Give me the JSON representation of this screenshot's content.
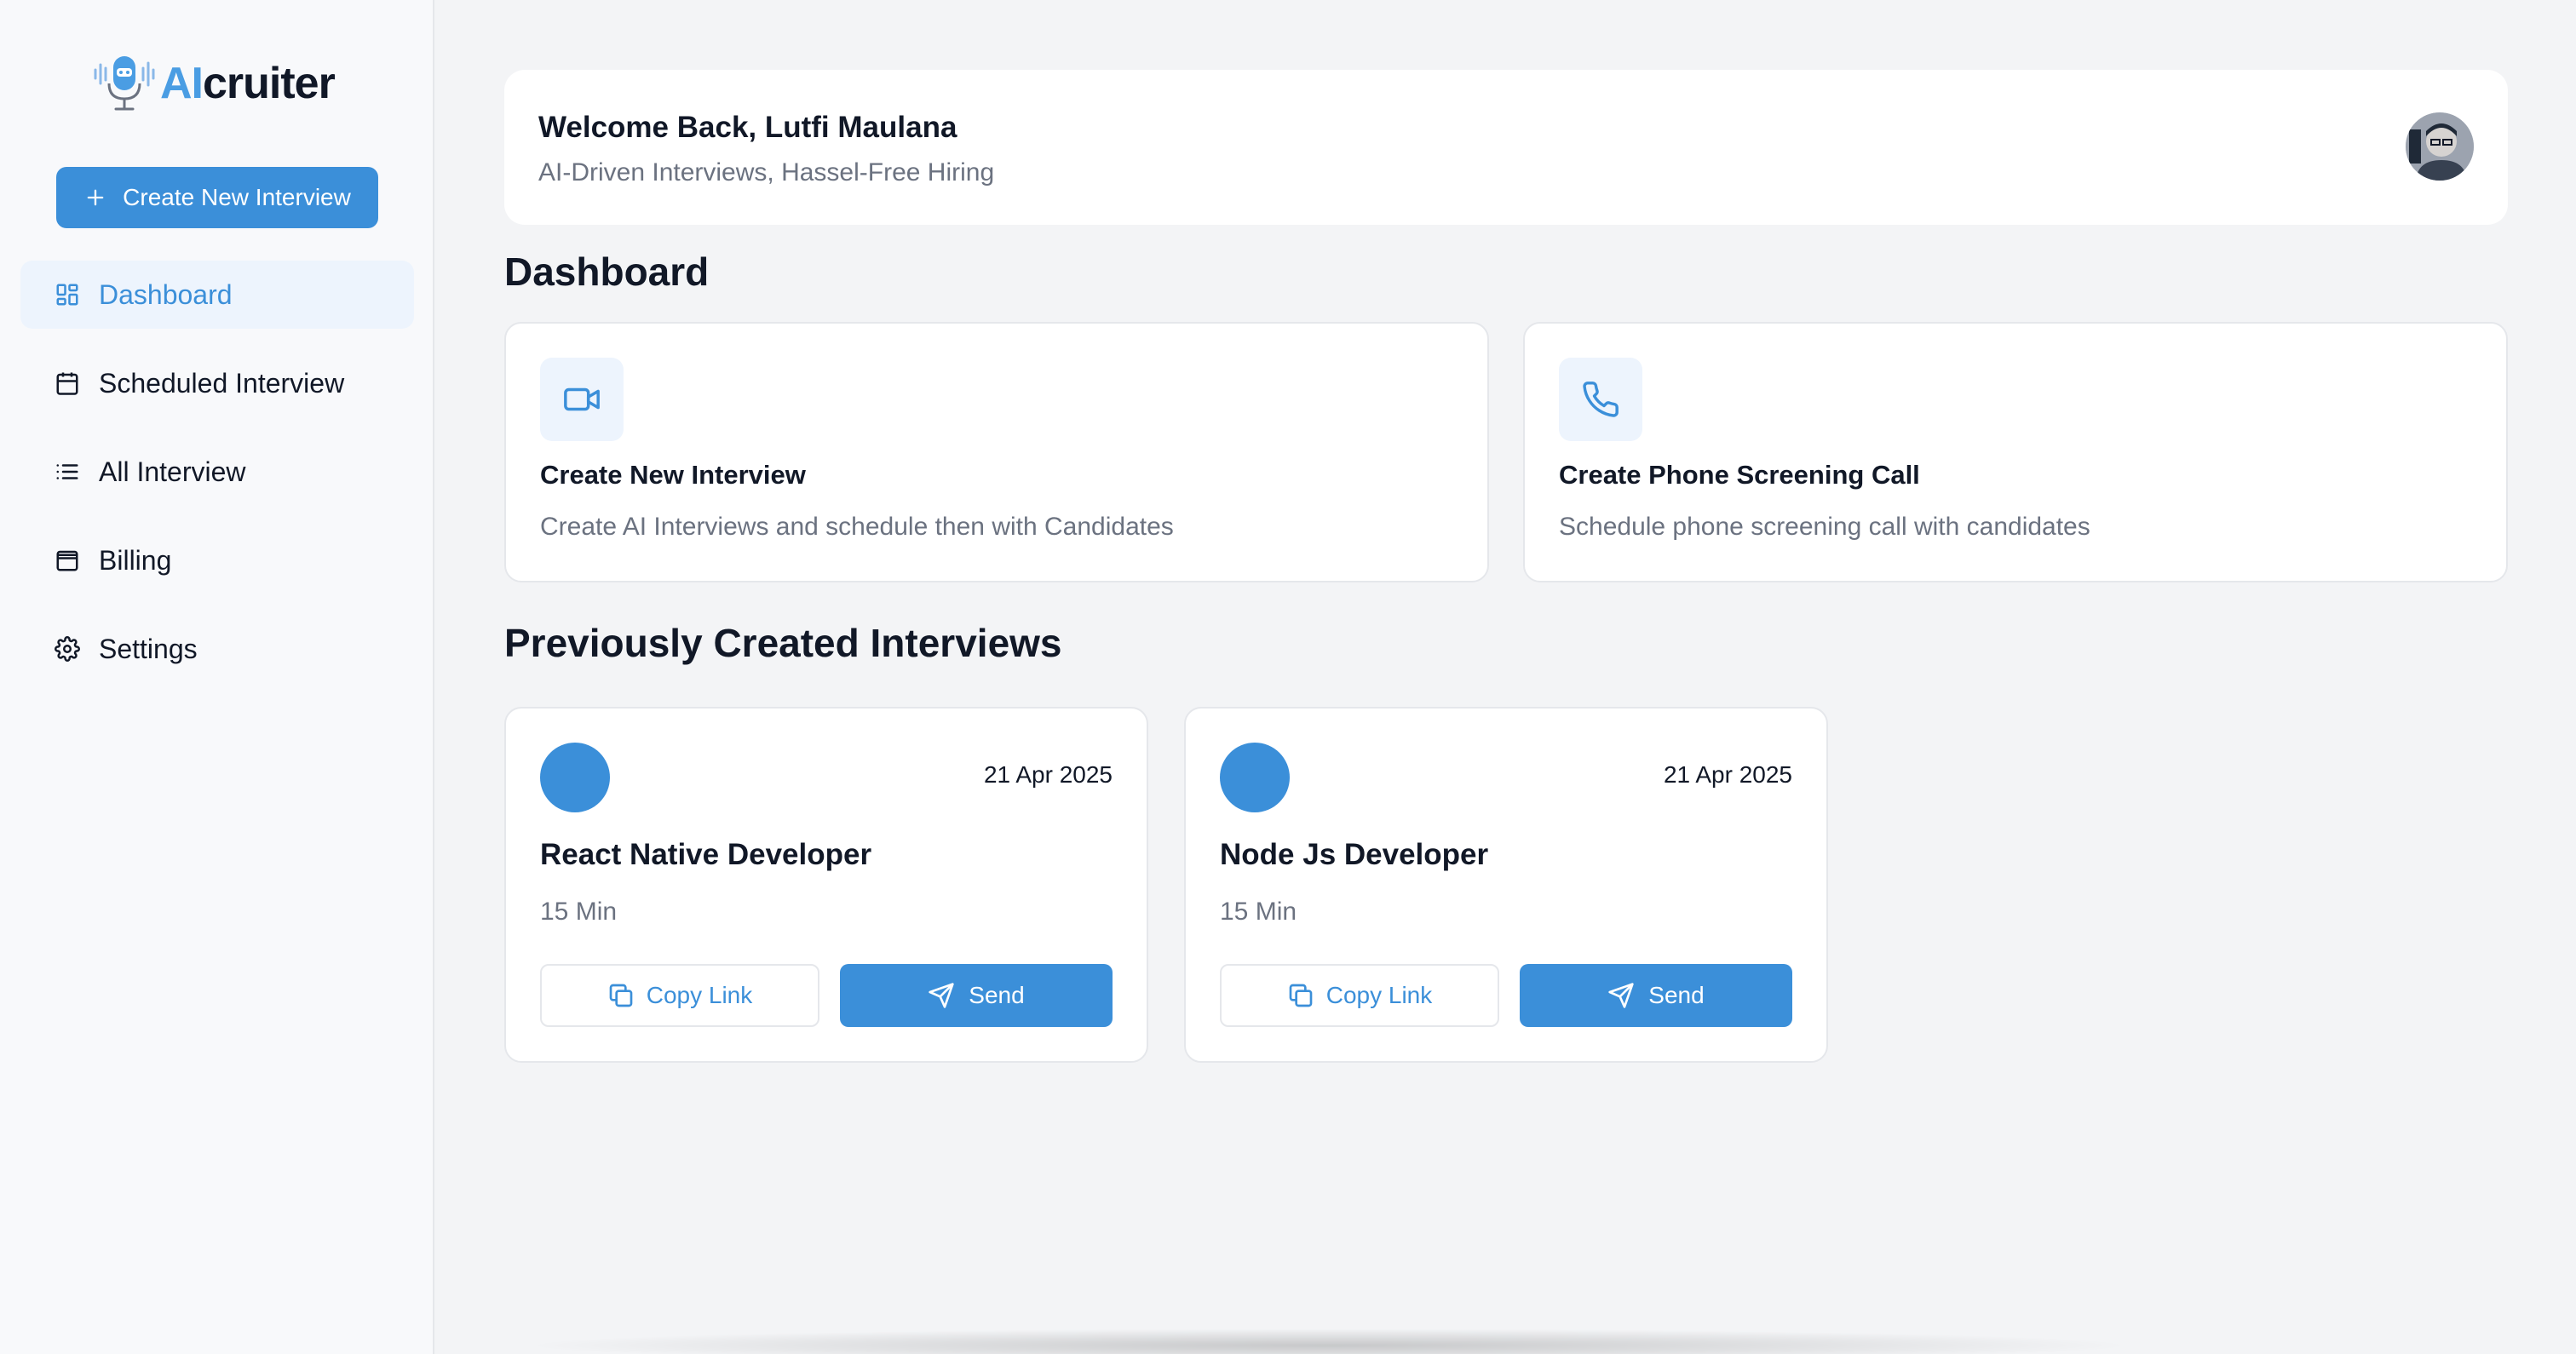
{
  "brand": {
    "ai": "AI",
    "rest": "cruiter"
  },
  "sidebar": {
    "create_label": "Create New Interview",
    "items": [
      {
        "label": "Dashboard",
        "icon": "dashboard-icon",
        "active": true
      },
      {
        "label": "Scheduled Interview",
        "icon": "calendar-icon"
      },
      {
        "label": "All Interview",
        "icon": "list-icon"
      },
      {
        "label": "Billing",
        "icon": "wallet-icon"
      },
      {
        "label": "Settings",
        "icon": "gear-icon"
      }
    ]
  },
  "welcome": {
    "title": "Welcome Back, Lutfi Maulana",
    "subtitle": "AI-Driven Interviews, Hassel-Free Hiring"
  },
  "dashboard": {
    "title": "Dashboard",
    "actions": [
      {
        "title": "Create New Interview",
        "desc": "Create AI Interviews and schedule then with Candidates",
        "icon": "video-icon"
      },
      {
        "title": "Create Phone Screening Call",
        "desc": "Schedule phone screening call with candidates",
        "icon": "phone-icon"
      }
    ]
  },
  "previous": {
    "title": "Previously Created Interviews",
    "copy_label": "Copy Link",
    "send_label": "Send",
    "interviews": [
      {
        "date": "21 Apr 2025",
        "title": "React Native Developer",
        "duration": "15 Min"
      },
      {
        "date": "21 Apr 2025",
        "title": "Node Js Developer",
        "duration": "15 Min"
      }
    ]
  },
  "colors": {
    "accent": "#3b8fd9",
    "accent_light": "#edf4fd"
  }
}
